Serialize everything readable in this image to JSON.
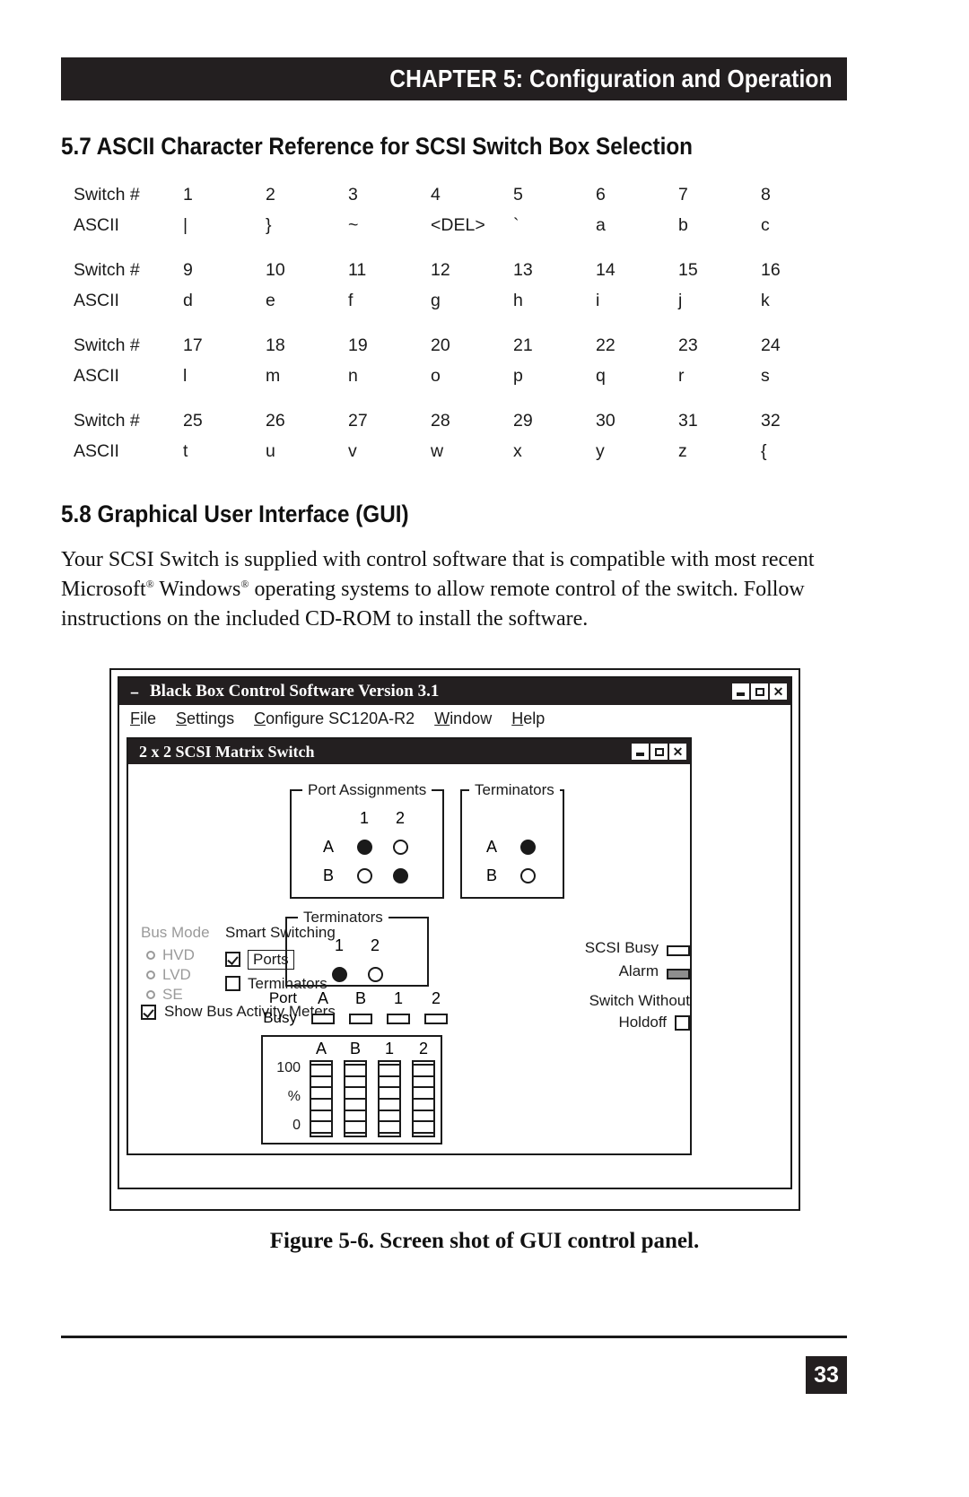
{
  "header": {
    "chapter_title": "CHAPTER 5: Configuration and Operation"
  },
  "sections": {
    "s57_heading": "5.7 ASCII Character Reference for SCSI Switch Box Selection",
    "s58_heading": "5.8 Graphical User Interface (GUI)"
  },
  "ascii_reference": {
    "row_label_switch": "Switch #",
    "row_label_ascii": "ASCII",
    "blocks": [
      {
        "switch": [
          "1",
          "2",
          "3",
          "4",
          "5",
          "6",
          "7",
          "8"
        ],
        "ascii": [
          "|",
          "}",
          "~",
          "<DEL>",
          "`",
          "a",
          "b",
          "c"
        ]
      },
      {
        "switch": [
          "9",
          "10",
          "11",
          "12",
          "13",
          "14",
          "15",
          "16"
        ],
        "ascii": [
          "d",
          "e",
          "f",
          "g",
          "h",
          "i",
          "j",
          "k"
        ]
      },
      {
        "switch": [
          "17",
          "18",
          "19",
          "20",
          "21",
          "22",
          "23",
          "24"
        ],
        "ascii": [
          "l",
          "m",
          "n",
          "o",
          "p",
          "q",
          "r",
          "s"
        ]
      },
      {
        "switch": [
          "25",
          "26",
          "27",
          "28",
          "29",
          "30",
          "31",
          "32"
        ],
        "ascii": [
          "t",
          "u",
          "v",
          "w",
          "x",
          "y",
          "z",
          "{"
        ]
      }
    ]
  },
  "body": {
    "paragraph_part1": "Your SCSI Switch is supplied with control software that is compatible with most recent Microsoft",
    "reg1": "®",
    "paragraph_part2": " Windows",
    "reg2": "®",
    "paragraph_part3": " operating systems to allow remote control of the switch. Follow instructions on the included CD-ROM to install the software."
  },
  "gui": {
    "app_title": "Black Box Control Software Version 3.1",
    "sysmenu_glyph": "–",
    "window_buttons": {
      "minimize": "minimize",
      "maximize": "maximize",
      "close": "✕"
    },
    "menu": [
      {
        "accel": "F",
        "rest": "ile"
      },
      {
        "accel": "S",
        "rest": "ettings"
      },
      {
        "accel": "C",
        "rest": "onfigure SC120A-R2"
      },
      {
        "accel": "W",
        "rest": "indow"
      },
      {
        "accel": "H",
        "rest": "elp"
      }
    ],
    "child_title": "2 x 2 SCSI Matrix Switch",
    "port_assignments": {
      "legend": "Port Assignments",
      "col_headers": [
        "1",
        "2"
      ],
      "rows": [
        {
          "label": "A",
          "states": [
            true,
            false
          ]
        },
        {
          "label": "B",
          "states": [
            false,
            true
          ]
        }
      ]
    },
    "terminators_ab": {
      "legend": "Terminators",
      "rows": [
        {
          "label": "A",
          "state": true
        },
        {
          "label": "B",
          "state": false
        }
      ]
    },
    "terminators_12": {
      "legend": "Terminators",
      "col_headers": [
        "1",
        "2"
      ],
      "states": [
        true,
        false
      ]
    },
    "bus_mode": {
      "title": "Bus Mode",
      "options": [
        {
          "label": "HVD",
          "selected": false
        },
        {
          "label": "LVD",
          "selected": false
        },
        {
          "label": "SE",
          "selected": false
        }
      ]
    },
    "smart_switching": {
      "title": "Smart Switching",
      "options": [
        {
          "label": "Ports",
          "checked": true,
          "focused": true
        },
        {
          "label": "Terminators",
          "checked": false,
          "focused": false
        }
      ]
    },
    "show_bus_activity": {
      "label": "Show Bus Activity Meters",
      "checked": true
    },
    "port_busy": {
      "label_line1": "Port",
      "label_line2": "Busy",
      "columns": [
        "A",
        "B",
        "1",
        "2"
      ],
      "states": [
        false,
        false,
        false,
        false
      ]
    },
    "activity_meters": {
      "scale_top": "100",
      "scale_unit": "%",
      "scale_bottom": "0",
      "columns": [
        "A",
        "B",
        "1",
        "2"
      ]
    },
    "status": {
      "scsi_busy_label": "SCSI Busy",
      "scsi_busy_on": false,
      "alarm_label": "Alarm",
      "alarm_on": true,
      "holdoff_line1": "Switch Without",
      "holdoff_line2": "Holdoff",
      "holdoff_checked": false
    }
  },
  "figure": {
    "caption": "Figure 5-6. Screen shot of GUI control panel."
  },
  "footer": {
    "page_number": "33"
  }
}
